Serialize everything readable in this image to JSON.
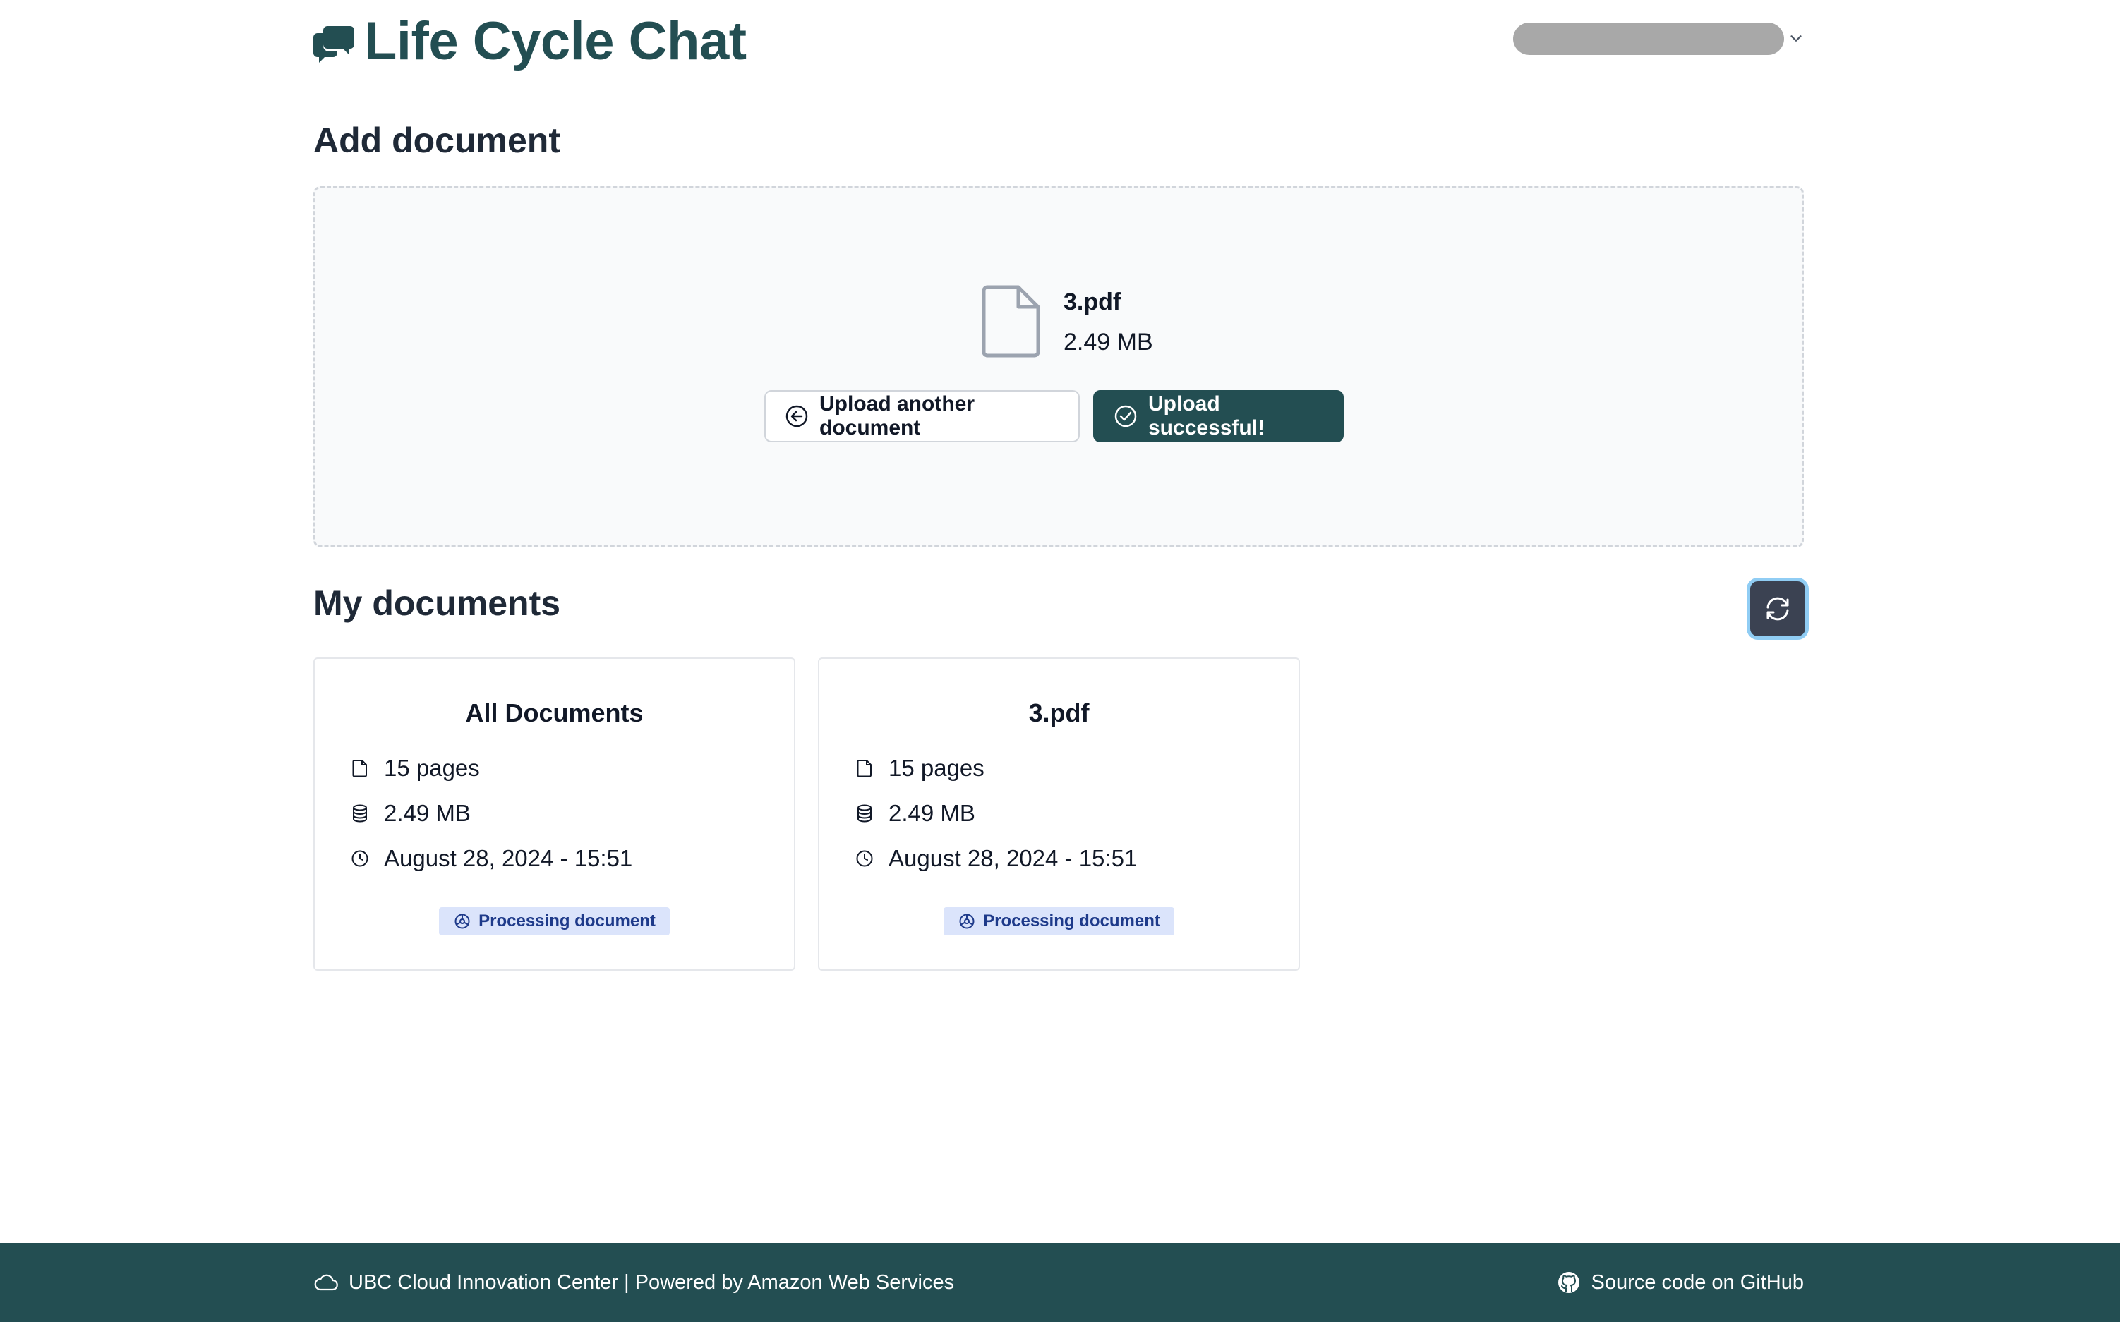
{
  "header": {
    "title": "Life Cycle Chat",
    "brand_icon": "chat-bubbles-icon",
    "user_menu_icon": "chevron-down-icon"
  },
  "add_document": {
    "title": "Add document",
    "file": {
      "name": "3.pdf",
      "size": "2.49 MB",
      "icon": "file-icon"
    },
    "upload_another_label": "Upload another document",
    "upload_success_label": "Upload successful!"
  },
  "my_documents": {
    "title": "My documents",
    "refresh_icon": "refresh-icon",
    "cards": [
      {
        "title": "All Documents",
        "pages": "15 pages",
        "size": "2.49 MB",
        "date": "August 28, 2024 - 15:51",
        "status": "Processing document"
      },
      {
        "title": "3.pdf",
        "pages": "15 pages",
        "size": "2.49 MB",
        "date": "August 28, 2024 - 15:51",
        "status": "Processing document"
      }
    ]
  },
  "footer": {
    "left_text": "UBC Cloud Innovation Center | Powered by Amazon Web Services",
    "right_text": "Source code on GitHub"
  },
  "colors": {
    "brand": "#234e52",
    "badge_bg": "#dbe4fb",
    "badge_text": "#1e3a8a",
    "refresh_bg": "#3b4252",
    "focus_ring": "#90cdf4"
  }
}
